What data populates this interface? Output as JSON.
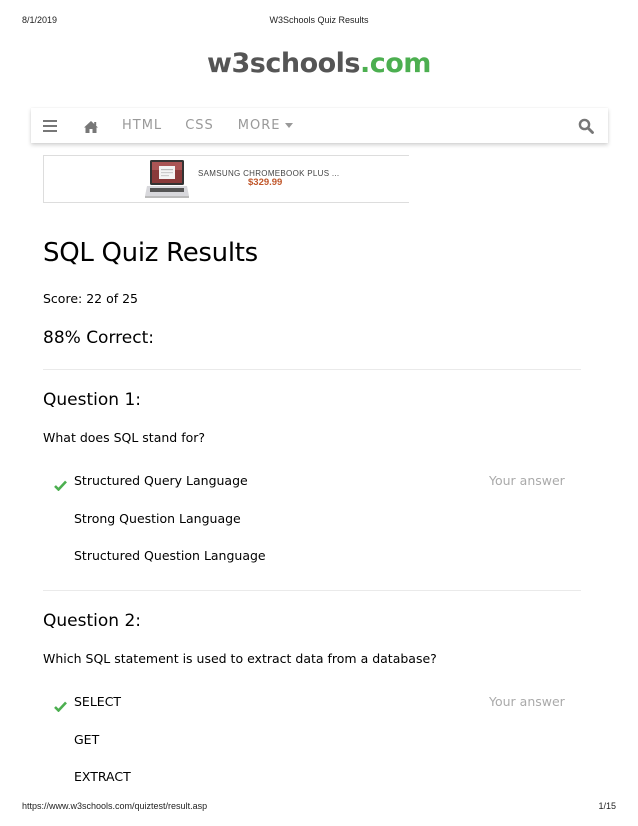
{
  "print_header": {
    "date": "8/1/2019",
    "title": "W3Schools Quiz Results"
  },
  "print_footer": {
    "url": "https://www.w3schools.com/quiztest/result.asp",
    "page": "1/15"
  },
  "logo": {
    "main": "w3schools",
    "tld": ".com"
  },
  "navbar": {
    "icons": [
      "menu-icon",
      "home-icon",
      "search-icon"
    ],
    "items": [
      {
        "label": "HTML"
      },
      {
        "label": "CSS"
      },
      {
        "label": "MORE"
      }
    ]
  },
  "ad": {
    "title": "SAMSUNG CHROMEBOOK PLUS ...",
    "price": "$329.99"
  },
  "colors": {
    "accent": "#4caf50",
    "price": "#c0562a",
    "muted": "#aaaaaa"
  },
  "results": {
    "title": "SQL Quiz Results",
    "score": "Score: 22 of 25",
    "percent": "88% Correct:"
  },
  "questions": [
    {
      "title": "Question 1:",
      "text": "What does SQL stand for?",
      "answers": [
        {
          "label": "Structured Query Language",
          "correct": true,
          "your_answer": "Your answer"
        },
        {
          "label": "Strong Question Language"
        },
        {
          "label": "Structured Question Language"
        }
      ]
    },
    {
      "title": "Question 2:",
      "text": "Which SQL statement is used to extract data from a database?",
      "answers": [
        {
          "label": "SELECT",
          "correct": true,
          "your_answer": "Your answer"
        },
        {
          "label": "GET"
        },
        {
          "label": "EXTRACT"
        }
      ]
    }
  ]
}
